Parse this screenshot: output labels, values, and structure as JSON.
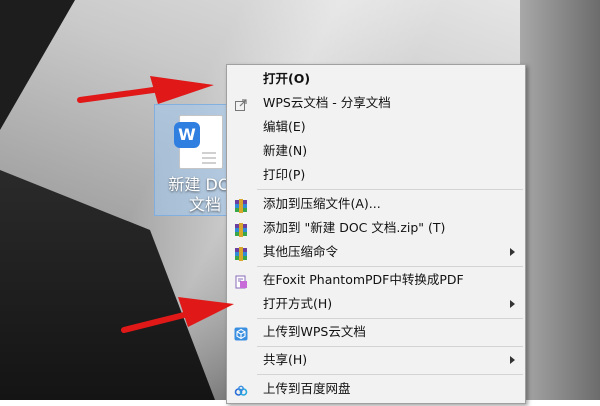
{
  "desktop": {
    "file_name_line1": "新建 DOC",
    "file_name_line2": "文档",
    "file_icon_letter": "W"
  },
  "context_menu": {
    "items": [
      {
        "label": "打开(O)",
        "bold": true,
        "icon": "none"
      },
      {
        "label": "WPS云文档 - 分享文档",
        "icon": "share-icon"
      },
      {
        "label": "编辑(E)",
        "icon": "none"
      },
      {
        "label": "新建(N)",
        "icon": "none"
      },
      {
        "label": "打印(P)",
        "icon": "none"
      },
      {
        "label": "添加到压缩文件(A)...",
        "icon": "winrar-icon"
      },
      {
        "label": "添加到 \"新建 DOC 文档.zip\" (T)",
        "icon": "winrar-icon"
      },
      {
        "label": "其他压缩命令",
        "icon": "winrar-icon",
        "submenu": true
      },
      {
        "label": "在Foxit PhantomPDF中转换成PDF",
        "icon": "pdf-convert-icon"
      },
      {
        "label": "打开方式(H)",
        "icon": "none",
        "submenu": true
      },
      {
        "label": "上传到WPS云文档",
        "icon": "cube-icon"
      },
      {
        "label": "共享(H)",
        "icon": "none",
        "submenu": true
      },
      {
        "label": "上传到百度网盘",
        "icon": "baidu-cloud-icon"
      }
    ]
  },
  "colors": {
    "annotation_arrow": "#e01818",
    "menu_background": "#f2f2f2",
    "selection_highlight": "#a0c8f0",
    "wps_blue": "#2f7fe0"
  }
}
